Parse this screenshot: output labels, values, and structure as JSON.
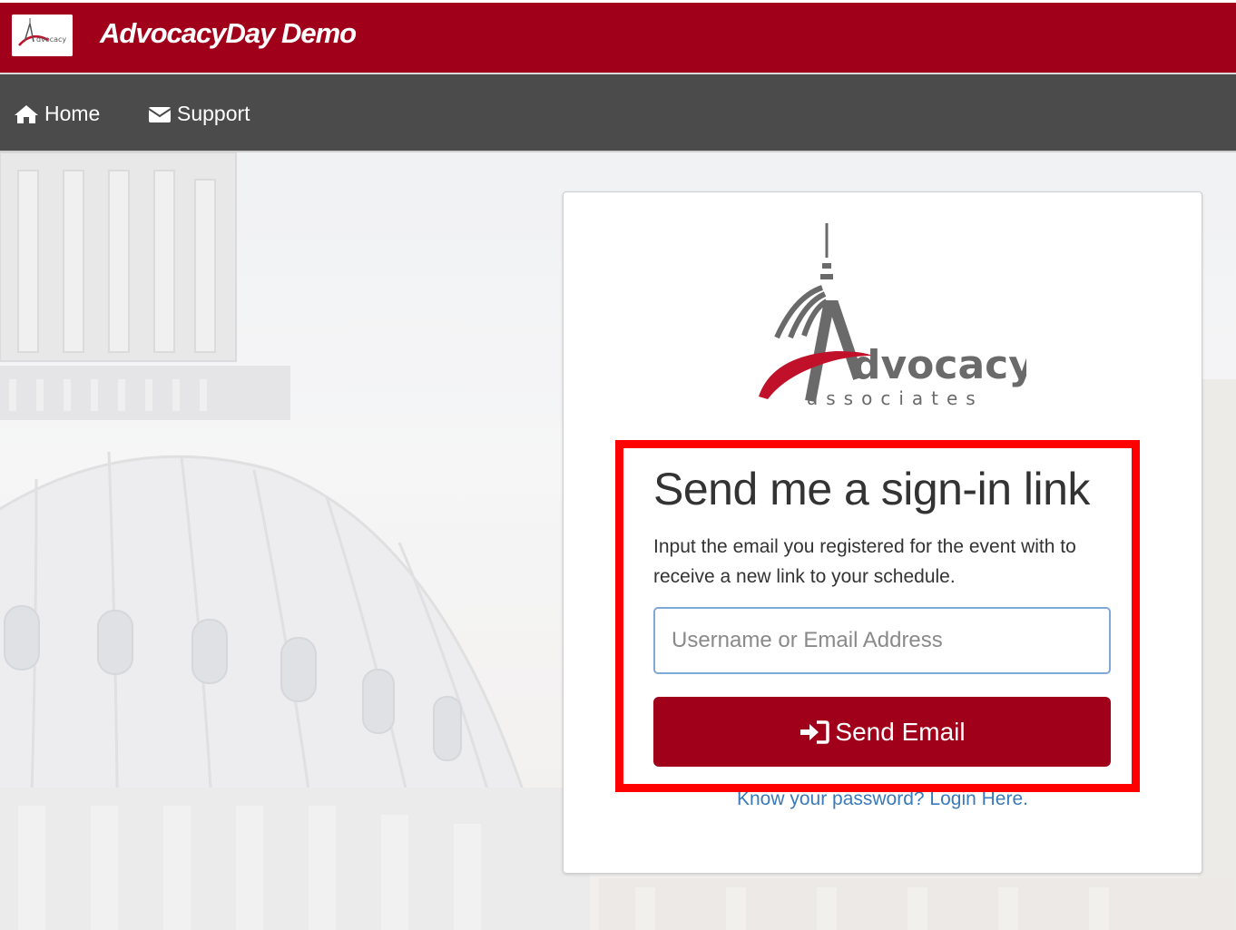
{
  "header": {
    "brand_title": "AdvocacyDay Demo",
    "logo_icon": "advocacy-associates-logo",
    "accent_color": "#a1001a"
  },
  "nav": {
    "items": [
      {
        "label": "Home",
        "icon": "home-icon"
      },
      {
        "label": "Support",
        "icon": "envelope-icon"
      }
    ]
  },
  "card": {
    "logo_text_main": "dvocacy",
    "logo_text_sub": "associates",
    "heading": "Send me a sign-in link",
    "description": "Input the email you registered for the event with to receive a new link to your schedule.",
    "email_placeholder": "Username or Email Address",
    "send_button_label": "Send Email",
    "send_button_icon": "sign-in-icon",
    "login_link": "Know your password? Login Here."
  },
  "colors": {
    "topbar": "#a1001a",
    "navbar": "#4b4b4b",
    "link": "#3a7ab8",
    "highlight": "#ff0000"
  }
}
